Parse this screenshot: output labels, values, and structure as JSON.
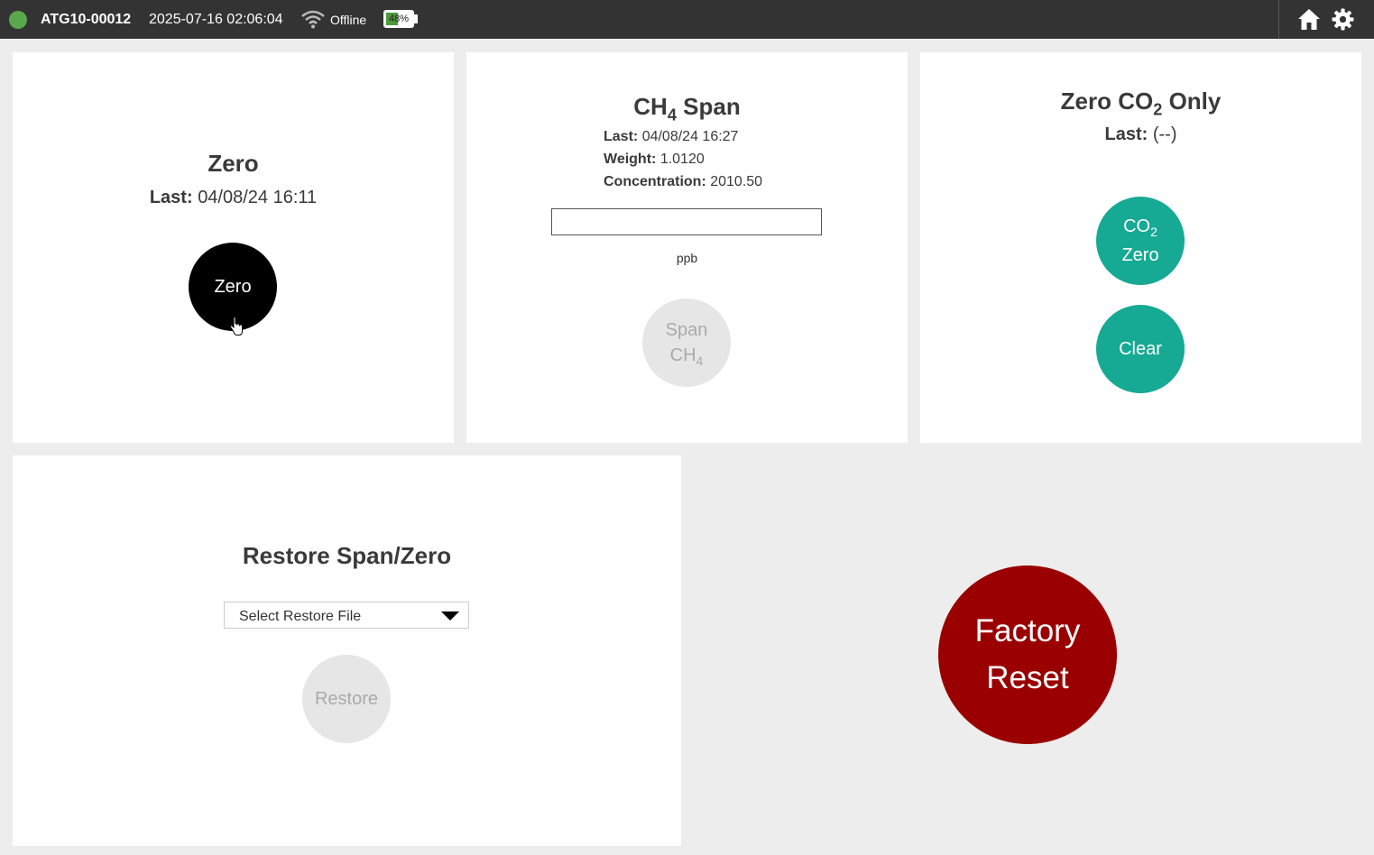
{
  "topbar": {
    "device_id": "ATG10-00012",
    "datetime": "2025-07-16 02:06:04",
    "connection_status": "Offline",
    "battery_label": "48%",
    "battery_level": 0.48,
    "status_color": "#5aa84c"
  },
  "zero_panel": {
    "title": "Zero",
    "last_label": "Last:",
    "last_value": "04/08/24 16:11",
    "button_label": "Zero"
  },
  "span_panel": {
    "title_main": "CH",
    "title_sub": "4",
    "title_tail": "Span",
    "last_label": "Last:",
    "last_value": "04/08/24 16:27",
    "weight_label": "Weight:",
    "weight_value": "1.0120",
    "concentration_label": "Concentration:",
    "concentration_value": "2010.50",
    "input_value": "",
    "unit_label": "ppb",
    "button_line1": "Span",
    "button_line2_main": "CH",
    "button_line2_sub": "4"
  },
  "co2_panel": {
    "title_pre": "Zero CO",
    "title_sub": "2",
    "title_tail": "Only",
    "last_label": "Last:",
    "last_value": "(--)",
    "zero_button_line1_main": "CO",
    "zero_button_line1_sub": "2",
    "zero_button_line2": "Zero",
    "clear_button": "Clear"
  },
  "restore_panel": {
    "title": "Restore Span/Zero",
    "select_value": "Select Restore File",
    "button_label": "Restore"
  },
  "factory_reset": {
    "line1": "Factory",
    "line2": "Reset"
  },
  "colors": {
    "teal": "#16a994",
    "factory_red": "#9a0000",
    "disabled_gray": "#e6e6e6",
    "topbar": "#333333"
  }
}
